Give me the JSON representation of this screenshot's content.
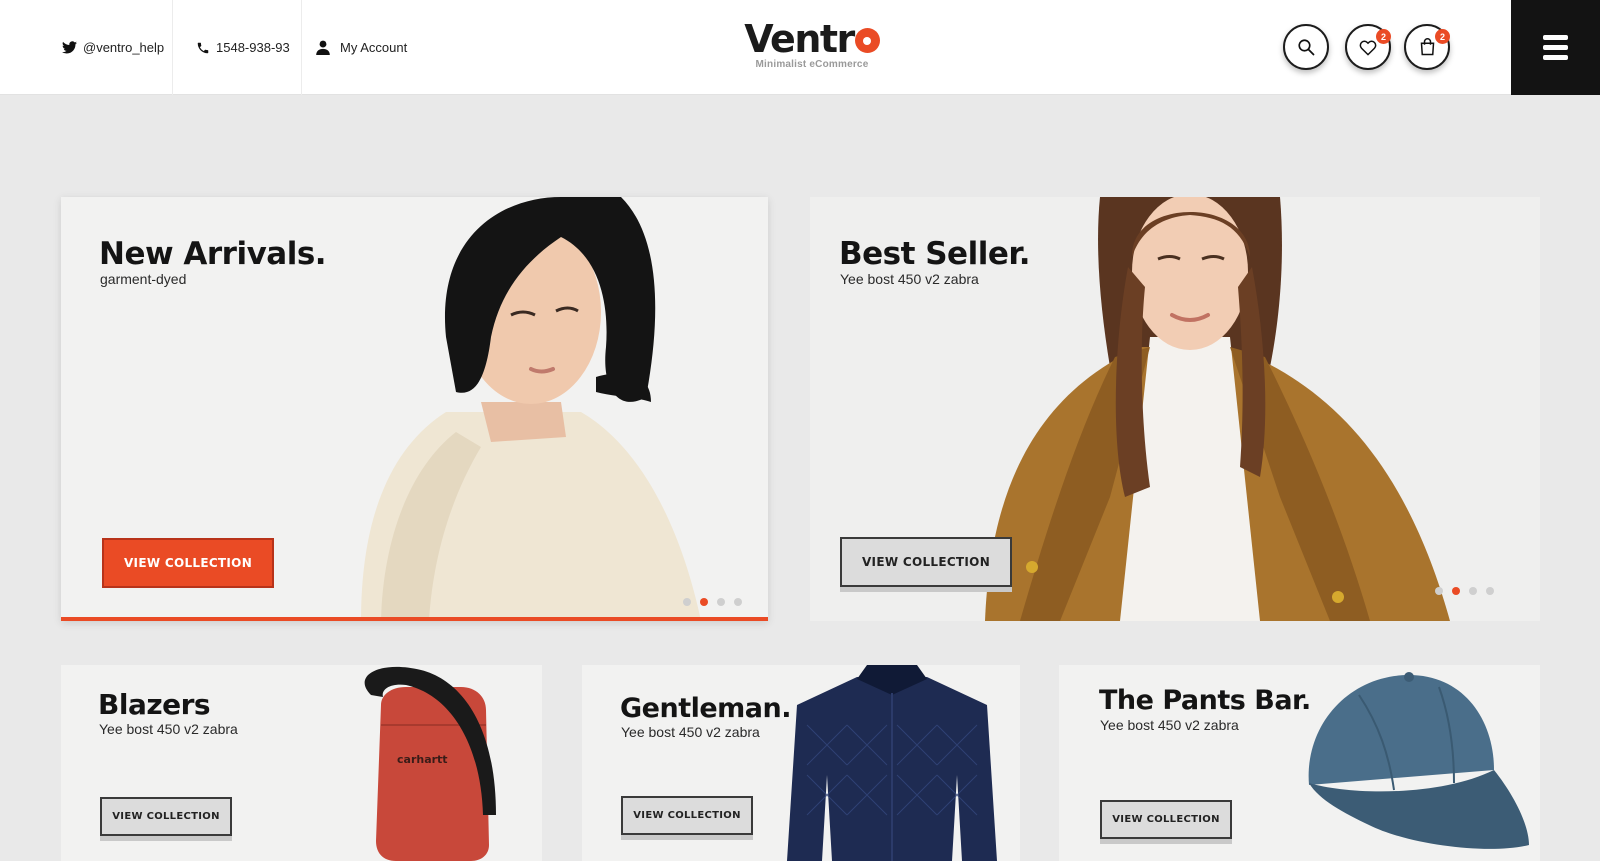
{
  "header": {
    "twitter": "@ventro_help",
    "phone": "1548-938-93",
    "account": "My Account",
    "logo_word": "Ventr",
    "logo_tagline": "Minimalist eCommerce",
    "wishlist_count": "2",
    "cart_count": "2"
  },
  "icons": {
    "twitter": "twitter-icon",
    "phone": "phone-icon",
    "user": "user-icon",
    "search": "search-icon",
    "wishlist": "heart-icon",
    "cart": "shopping-bag-icon",
    "menu": "hamburger-menu-icon"
  },
  "hero": [
    {
      "title": "New Arrivals.",
      "subtitle": "garment-dyed",
      "button": "VIEW COLLECTION",
      "slides": 4,
      "active_slide": 2
    },
    {
      "title": "Best Seller.",
      "subtitle": "Yee bost 450 v2 zabra",
      "button": "VIEW COLLECTION",
      "slides": 4,
      "active_slide": 2
    }
  ],
  "categories": [
    {
      "title": "Blazers",
      "subtitle": "Yee bost 450 v2 zabra",
      "button": "VIEW COLLECTION",
      "product_label": "carhartt"
    },
    {
      "title": "Gentleman.",
      "subtitle": "Yee bost 450 v2 zabra",
      "button": "VIEW COLLECTION"
    },
    {
      "title": "The Pants Bar.",
      "subtitle": "Yee bost 450 v2 zabra",
      "button": "VIEW COLLECTION"
    }
  ],
  "colors": {
    "accent": "#ea4b25",
    "page_bg": "#e9e9e9",
    "menu_bg": "#131313"
  }
}
